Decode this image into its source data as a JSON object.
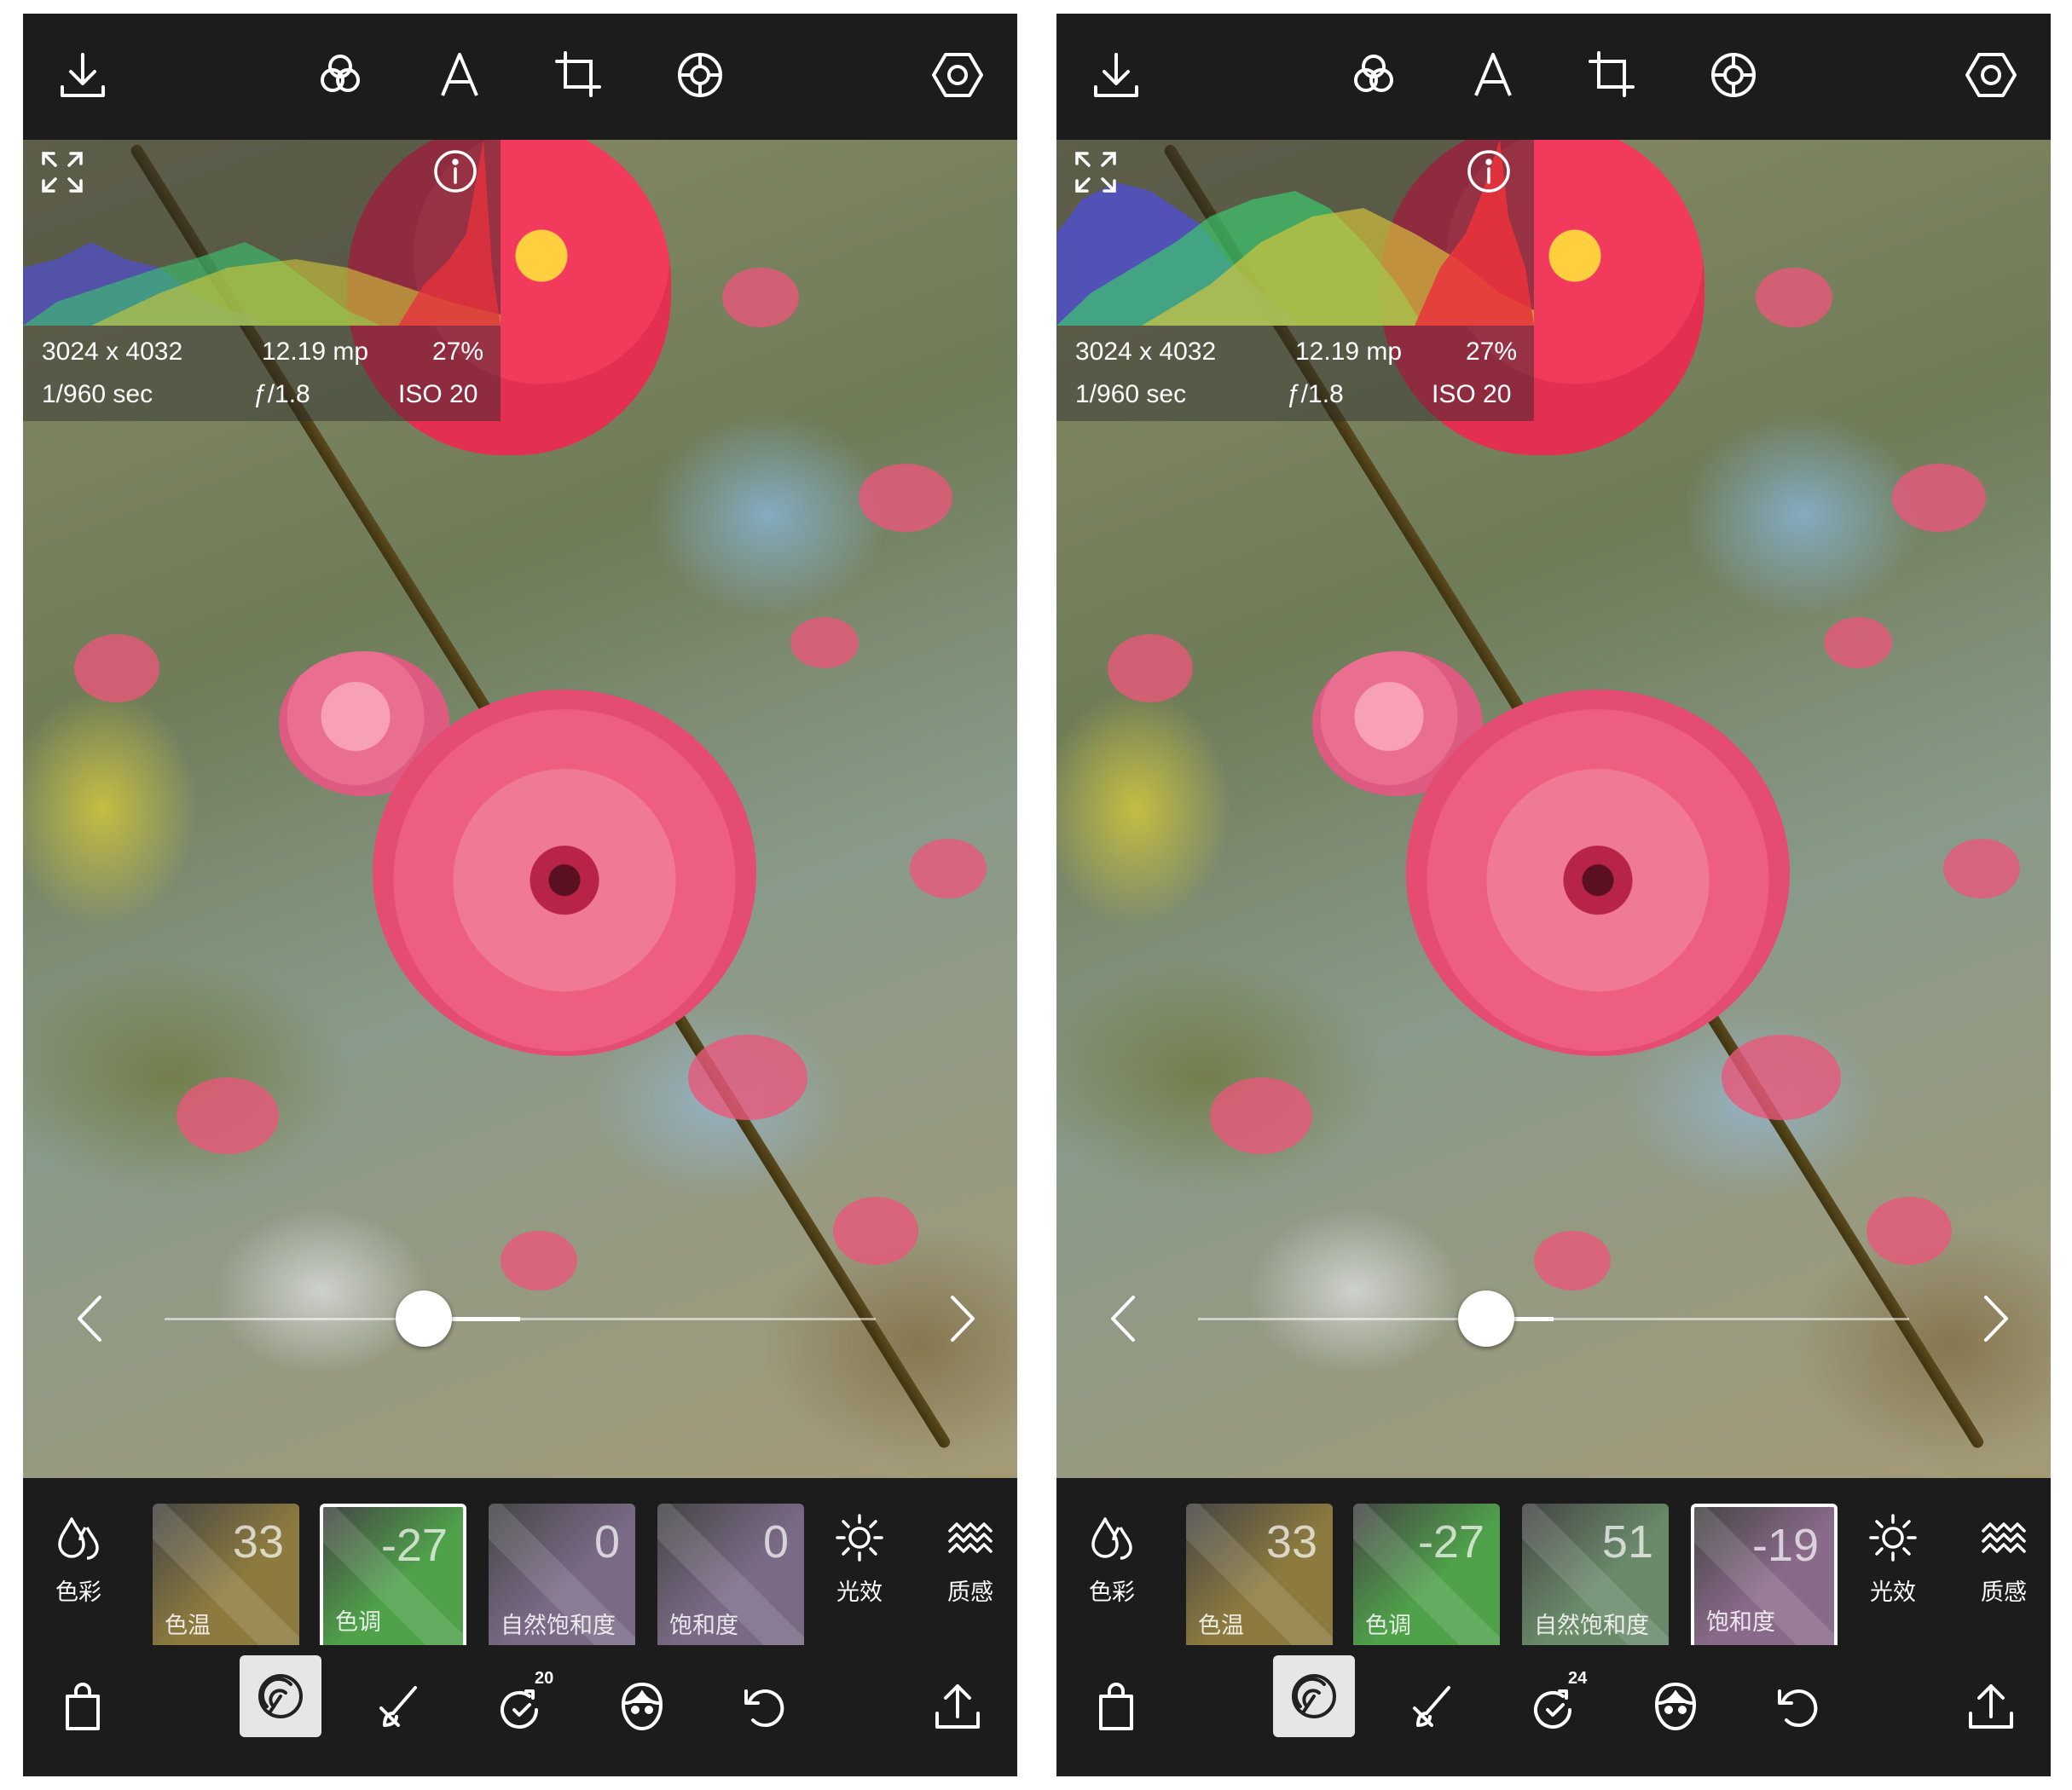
{
  "screens": [
    {
      "id": "left",
      "meta": {
        "resolution": "3024 x 4032",
        "megapixels": "12.19 mp",
        "zoom": "27%",
        "shutter": "1/960 sec",
        "aperture": "ƒ/1.8",
        "iso": "ISO 20"
      },
      "slider_value": -27,
      "slider_range": [
        -100,
        100
      ],
      "tools": {
        "left": "色彩",
        "right1": "光效",
        "right2": "质感"
      },
      "tiles": [
        {
          "value": "33",
          "label": "色温",
          "selected": false,
          "color": "#8c7a3e"
        },
        {
          "value": "-27",
          "label": "色调",
          "selected": true,
          "color": "#4fa14a"
        },
        {
          "value": "0",
          "label": "自然饱和度",
          "selected": false,
          "color": "#7a6a86"
        },
        {
          "value": "0",
          "label": "饱和度",
          "selected": false,
          "color": "#7a6a86"
        }
      ],
      "history_count": "20"
    },
    {
      "id": "right",
      "meta": {
        "resolution": "3024 x 4032",
        "megapixels": "12.19 mp",
        "zoom": "27%",
        "shutter": "1/960 sec",
        "aperture": "ƒ/1.8",
        "iso": "ISO 20"
      },
      "slider_value": -19,
      "slider_range": [
        -100,
        100
      ],
      "tools": {
        "left": "色彩",
        "right1": "光效",
        "right2": "质感"
      },
      "tiles": [
        {
          "value": "33",
          "label": "色温",
          "selected": false,
          "color": "#8c7a3e"
        },
        {
          "value": "-27",
          "label": "色调",
          "selected": false,
          "color": "#4fa14a"
        },
        {
          "value": "51",
          "label": "自然饱和度",
          "selected": false,
          "color": "#6a8a6a"
        },
        {
          "value": "-19",
          "label": "饱和度",
          "selected": true,
          "color": "#8a6a8a"
        }
      ],
      "history_count": "24"
    }
  ],
  "icons": {
    "top": [
      "download-icon",
      "filters-icon",
      "text-icon",
      "crop-icon",
      "lens-icon",
      "settings-icon"
    ],
    "bottom": [
      "bag-icon",
      "adjust-icon",
      "brush-icon",
      "history-icon",
      "face-icon",
      "undo-icon",
      "share-icon"
    ]
  }
}
